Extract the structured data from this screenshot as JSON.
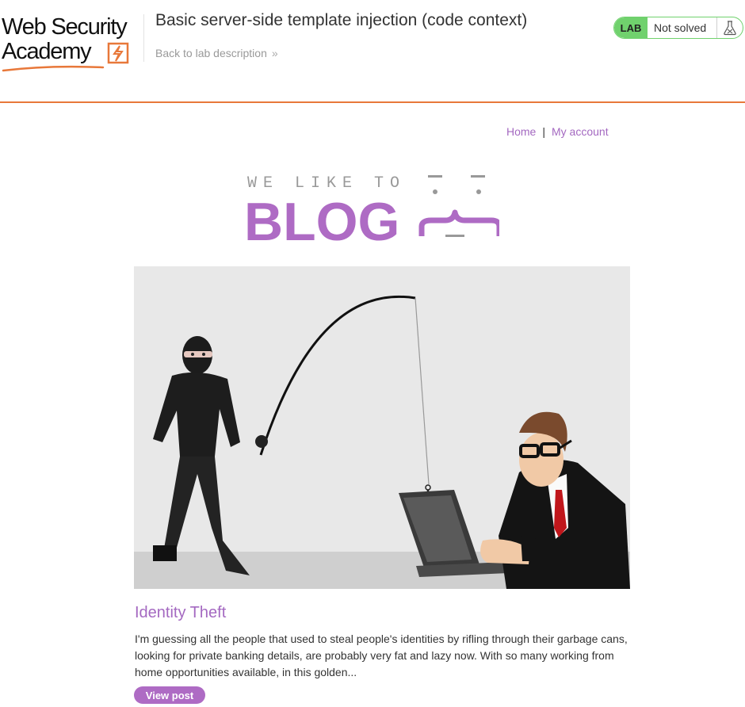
{
  "academy": {
    "logo_line1": "Web Security",
    "logo_line2": "Academy",
    "lab_title": "Basic server-side template injection (code context)",
    "back_link": "Back to lab description",
    "lab_badge": "LAB",
    "status": "Not solved",
    "colors": {
      "accent": "#e8783a",
      "badge": "#70d16d"
    }
  },
  "blog": {
    "nav": {
      "home": "Home",
      "separator": "|",
      "my_account": "My account"
    },
    "banner": {
      "small": "WE LIKE TO",
      "big": "BLOG"
    },
    "post": {
      "title": "Identity Theft",
      "summary": "I'm guessing all the people that used to steal people's identities by rifling through their garbage cans, looking for private banking details, are probably very fat and lazy now. With so many working from home opportunities available, in this golden...",
      "button": "View post"
    },
    "colors": {
      "accent": "#ae6bc4"
    }
  }
}
